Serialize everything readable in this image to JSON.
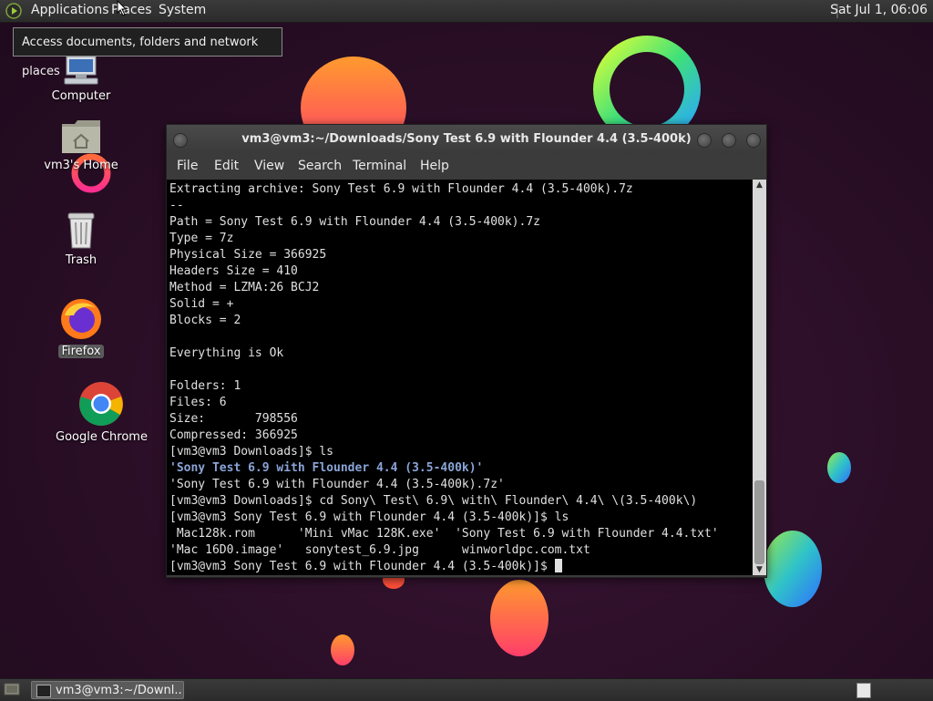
{
  "panel": {
    "menus": [
      "Applications",
      "Places",
      "System"
    ],
    "clock": "Sat Jul 1, 06:06"
  },
  "tooltip": "Access documents, folders and network places",
  "desktop": {
    "icons": [
      {
        "label": "Computer",
        "icon": "computer-icon"
      },
      {
        "label": "vm3's Home",
        "icon": "home-folder-icon"
      },
      {
        "label": "Trash",
        "icon": "trash-icon"
      },
      {
        "label": "Firefox",
        "icon": "firefox-icon"
      },
      {
        "label": "Google Chrome",
        "icon": "chrome-icon"
      }
    ]
  },
  "window": {
    "title": "vm3@vm3:~/Downloads/Sony Test 6.9 with Flounder 4.4 (3.5-400k)",
    "menu": [
      "File",
      "Edit",
      "View",
      "Search",
      "Terminal",
      "Help"
    ],
    "lines": [
      {
        "text": "Extracting archive: Sony Test 6.9 with Flounder 4.4 (3.5-400k).7z",
        "style": ""
      },
      {
        "text": "--",
        "style": ""
      },
      {
        "text": "Path = Sony Test 6.9 with Flounder 4.4 (3.5-400k).7z",
        "style": ""
      },
      {
        "text": "Type = 7z",
        "style": ""
      },
      {
        "text": "Physical Size = 366925",
        "style": ""
      },
      {
        "text": "Headers Size = 410",
        "style": ""
      },
      {
        "text": "Method = LZMA:26 BCJ2",
        "style": ""
      },
      {
        "text": "Solid = +",
        "style": ""
      },
      {
        "text": "Blocks = 2",
        "style": ""
      },
      {
        "text": "",
        "style": ""
      },
      {
        "text": "Everything is Ok",
        "style": ""
      },
      {
        "text": "",
        "style": ""
      },
      {
        "text": "Folders: 1",
        "style": ""
      },
      {
        "text": "Files: 6",
        "style": ""
      },
      {
        "text": "Size:       798556",
        "style": ""
      },
      {
        "text": "Compressed: 366925",
        "style": ""
      },
      {
        "text": "[vm3@vm3 Downloads]$ ls",
        "style": ""
      },
      {
        "text": "'Sony Test 6.9 with Flounder 4.4 (3.5-400k)'",
        "style": "bold-blue"
      },
      {
        "text": "'Sony Test 6.9 with Flounder 4.4 (3.5-400k).7z'",
        "style": ""
      },
      {
        "text": "[vm3@vm3 Downloads]$ cd Sony\\ Test\\ 6.9\\ with\\ Flounder\\ 4.4\\ \\(3.5-400k\\)",
        "style": ""
      },
      {
        "text": "[vm3@vm3 Sony Test 6.9 with Flounder 4.4 (3.5-400k)]$ ls",
        "style": ""
      },
      {
        "text": " Mac128k.rom      'Mini vMac 128K.exe'  'Sony Test 6.9 with Flounder 4.4.txt'",
        "style": ""
      },
      {
        "text": "'Mac 16D0.image'   sonytest_6.9.jpg      winworldpc.com.txt",
        "style": ""
      },
      {
        "text": "[vm3@vm3 Sony Test 6.9 with Flounder 4.4 (3.5-400k)]$ ",
        "style": ""
      }
    ]
  },
  "taskbar": {
    "task_label": "vm3@vm3:~/Downl..."
  }
}
